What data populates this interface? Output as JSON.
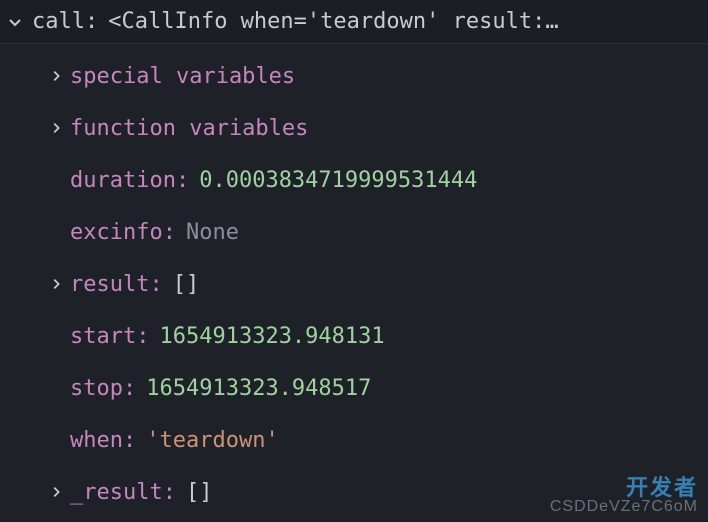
{
  "header": {
    "label": "call:",
    "value": "<CallInfo when='teardown' result:…"
  },
  "rows": [
    {
      "expandable": true,
      "key": "special variables",
      "valueText": "",
      "valueClass": ""
    },
    {
      "expandable": true,
      "key": "function variables",
      "valueText": "",
      "valueClass": ""
    },
    {
      "expandable": false,
      "key": "duration:",
      "valueText": "0.0003834719999531444",
      "valueClass": "val-num"
    },
    {
      "expandable": false,
      "key": "excinfo:",
      "valueText": "None",
      "valueClass": "val-none"
    },
    {
      "expandable": true,
      "key": "result:",
      "valueText": "[]",
      "valueClass": "val-punc"
    },
    {
      "expandable": false,
      "key": "start:",
      "valueText": "1654913323.948131",
      "valueClass": "val-num"
    },
    {
      "expandable": false,
      "key": "stop:",
      "valueText": "1654913323.948517",
      "valueClass": "val-num"
    },
    {
      "expandable": false,
      "key": "when:",
      "valueText": "'teardown'",
      "valueClass": "val-str"
    },
    {
      "expandable": true,
      "key": "_result:",
      "valueText": "[]",
      "valueClass": "val-punc"
    }
  ],
  "watermark": {
    "line1": "开发者",
    "line2": "CSDDeVZe7C6oM"
  }
}
